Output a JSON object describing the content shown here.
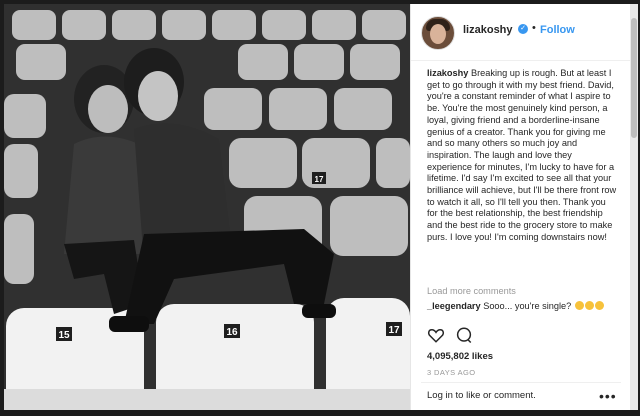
{
  "post": {
    "username": "lizakoshy",
    "follow_label": "Follow",
    "caption_user": "lizakoshy",
    "caption_text": "Breaking up is rough. But at least I get to go through it with my best friend. David, you're a constant reminder of what I aspire to be. You're the most genuinely kind person, a loyal, giving friend and a borderline-insane genius of a creator. Thank you for giving me and so many others so much joy and inspiration. The laugh and love they experience for minutes, I'm lucky to have for a lifetime. I'd say I'm excited to see all that your brilliance will achieve, but I'll be there front row to watch it all, so I'll tell you then. Thank you for the best relationship, the best friendship and the best ride to the grocery store to make purs. I love you! I'm coming downstairs now!",
    "load_more": "Load more comments",
    "comment_user": "_leegendary",
    "comment_text": "Sooo... you're single?",
    "likes": "4,095,802 likes",
    "time": "3 DAYS AGO",
    "login_text": "Log in",
    "login_suffix": "to like or comment."
  },
  "photo": {
    "seat_numbers": [
      "15",
      "16",
      "17",
      "17"
    ]
  },
  "icons": {
    "heart": "heart-icon",
    "comment": "comment-icon",
    "more": "more-options-icon",
    "verified": "verified-icon"
  },
  "colors": {
    "link_blue": "#3897f0",
    "text": "#262626",
    "muted": "#999999"
  }
}
